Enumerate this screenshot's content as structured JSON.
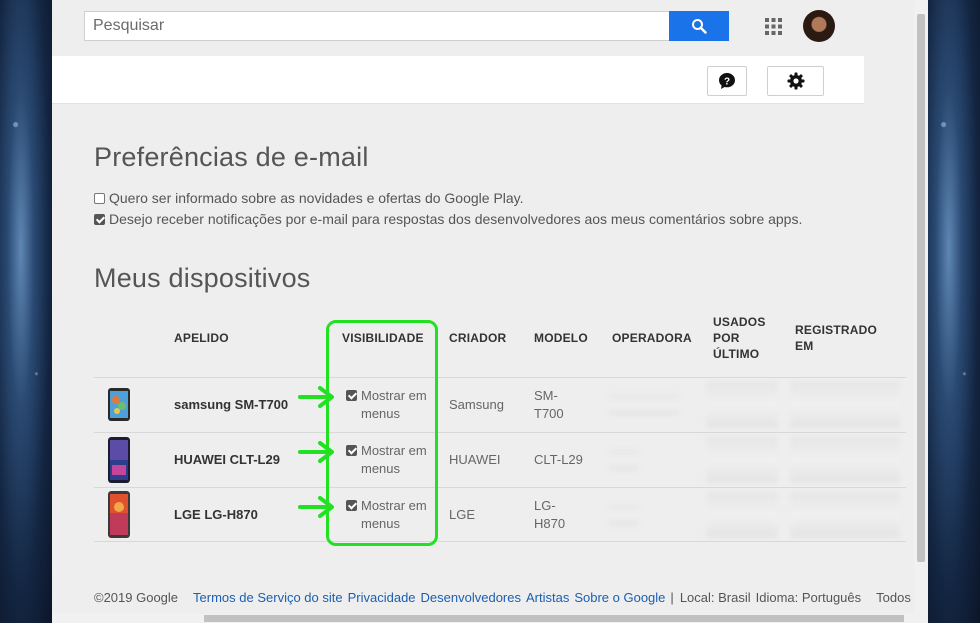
{
  "search": {
    "placeholder": "Pesquisar",
    "value": ""
  },
  "email_prefs": {
    "title": "Preferências de e-mail",
    "options": [
      {
        "label": "Quero ser informado sobre as novidades e ofertas do Google Play.",
        "checked": false
      },
      {
        "label": "Desejo receber notificações por e-mail para respostas dos desenvolvedores aos meus comentários sobre apps.",
        "checked": true
      }
    ]
  },
  "devices": {
    "title": "Meus dispositivos",
    "headers": {
      "nickname": "APELIDO",
      "visibility": "VISIBILIDADE",
      "maker": "CRIADOR",
      "model": "MODELO",
      "carrier": "OPERADORA",
      "last_used_1": "USADOS",
      "last_used_2": "POR",
      "last_used_3": "ÚLTIMO",
      "registered_1": "REGISTRADO",
      "registered_2": "EM"
    },
    "rows": [
      {
        "nickname": "samsung SM-T700",
        "visibility_1": "Mostrar em",
        "visibility_2": "menus",
        "visible": true,
        "maker": "Samsung",
        "model_1": "SM-",
        "model_2": "T700"
      },
      {
        "nickname": "HUAWEI CLT-L29",
        "visibility_1": "Mostrar em",
        "visibility_2": "menus",
        "visible": true,
        "maker": "HUAWEI",
        "model_1": "CLT-L29",
        "model_2": ""
      },
      {
        "nickname": "LGE LG-H870",
        "visibility_1": "Mostrar em",
        "visibility_2": "menus",
        "visible": true,
        "maker": "LGE",
        "model_1": "LG-",
        "model_2": "H870"
      }
    ]
  },
  "footer": {
    "copyright": "©2019 Google",
    "links": [
      "Termos de Serviço do site",
      "Privacidade",
      "Desenvolvedores",
      "Artistas",
      "Sobre o Google"
    ],
    "separator": "|",
    "location": "Local: Brasil",
    "language": "Idioma: Português",
    "all": "Todos"
  },
  "colors": {
    "accent_blue": "#1a73e8",
    "highlight_green": "#22e022",
    "link": "#1a5fb4"
  }
}
